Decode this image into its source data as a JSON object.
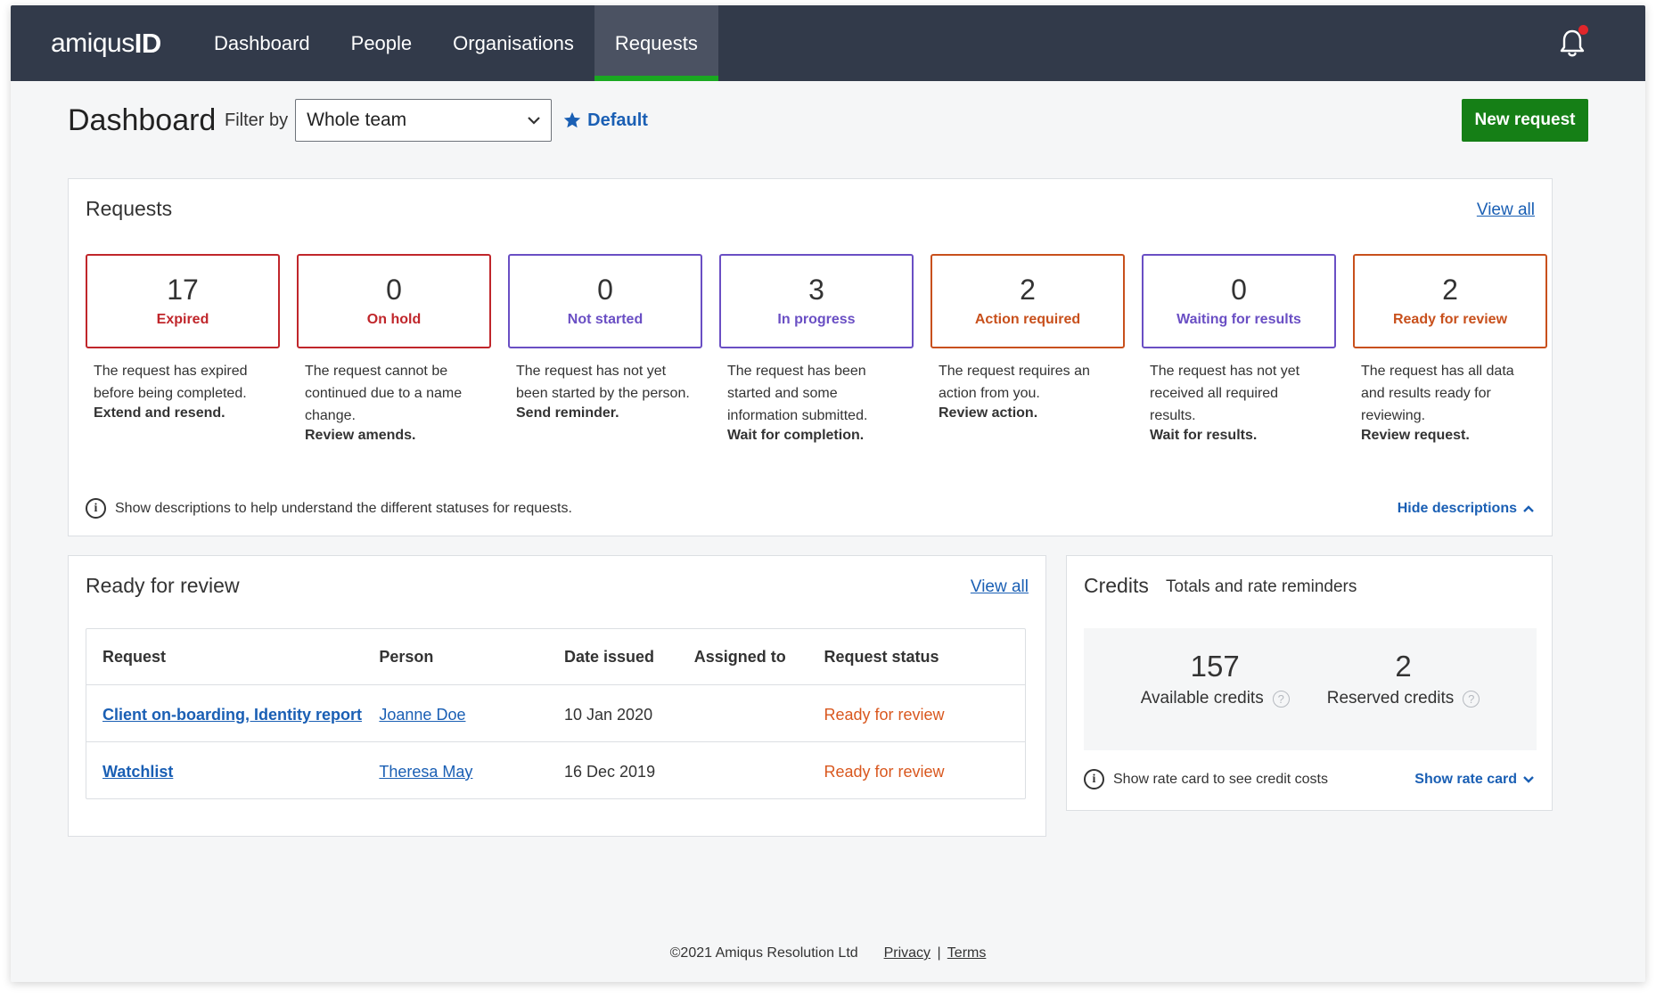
{
  "nav": {
    "logo_text": "amiqus",
    "logo_id": "ID",
    "items": [
      {
        "label": "Dashboard",
        "active": false
      },
      {
        "label": "People",
        "active": false
      },
      {
        "label": "Organisations",
        "active": false
      },
      {
        "label": "Requests",
        "active": true
      }
    ]
  },
  "header": {
    "title": "Dashboard",
    "filter_label": "Filter by",
    "filter_value": "Whole team",
    "default_label": "Default",
    "new_request_label": "New request"
  },
  "requests": {
    "title": "Requests",
    "view_all": "View all",
    "statuses": [
      {
        "count": "17",
        "label": "Expired",
        "color": "#c0262b",
        "desc": "The request has expired before being completed.",
        "action": "Extend and resend."
      },
      {
        "count": "0",
        "label": "On hold",
        "color": "#c0262b",
        "desc": "The request cannot be continued due to a name change.",
        "action": "Review amends."
      },
      {
        "count": "0",
        "label": "Not started",
        "color": "#6a4fc4",
        "desc": "The request has not yet been started by the person.",
        "action": "Send reminder."
      },
      {
        "count": "3",
        "label": "In progress",
        "color": "#6a4fc4",
        "desc": "The request has been started and some information submitted.",
        "action": "Wait for completion."
      },
      {
        "count": "2",
        "label": "Action required",
        "color": "#c8501c",
        "desc": "The request requires an action from you.",
        "action": "Review action."
      },
      {
        "count": "0",
        "label": "Waiting for results",
        "color": "#6a4fc4",
        "desc": "The request has not yet received all required results.",
        "action": "Wait for results."
      },
      {
        "count": "2",
        "label": "Ready for review",
        "color": "#c8501c",
        "desc": "The request has all data and results ready for reviewing.",
        "action": "Review request."
      }
    ],
    "info_text": "Show descriptions to help understand the different statuses for requests.",
    "hide_descriptions": "Hide descriptions"
  },
  "review": {
    "title": "Ready for review",
    "view_all": "View all",
    "columns": [
      "Request",
      "Person",
      "Date issued",
      "Assigned to",
      "Request status"
    ],
    "rows": [
      {
        "request": "Client on-boarding, Identity report",
        "person": "Joanne Doe",
        "date": "10 Jan 2020",
        "assigned": "",
        "status": "Ready for review"
      },
      {
        "request": "Watchlist",
        "person": "Theresa May",
        "date": "16 Dec 2019",
        "assigned": "",
        "status": "Ready for review"
      }
    ]
  },
  "credits": {
    "title": "Credits",
    "subtitle": "Totals and rate reminders",
    "available": {
      "value": "157",
      "label": "Available credits"
    },
    "reserved": {
      "value": "2",
      "label": "Reserved credits"
    },
    "info_text": "Show rate card to see credit costs",
    "show_rate_card": "Show rate card"
  },
  "footer": {
    "copyright": "©2021 Amiqus Resolution Ltd",
    "privacy": "Privacy",
    "separator": "|",
    "terms": "Terms"
  },
  "colors": {
    "nav_bg": "#323a4a",
    "active_underline": "#1aa821",
    "primary_button": "#157f16",
    "link": "#1a5fb4",
    "review_status": "#d9581f"
  }
}
